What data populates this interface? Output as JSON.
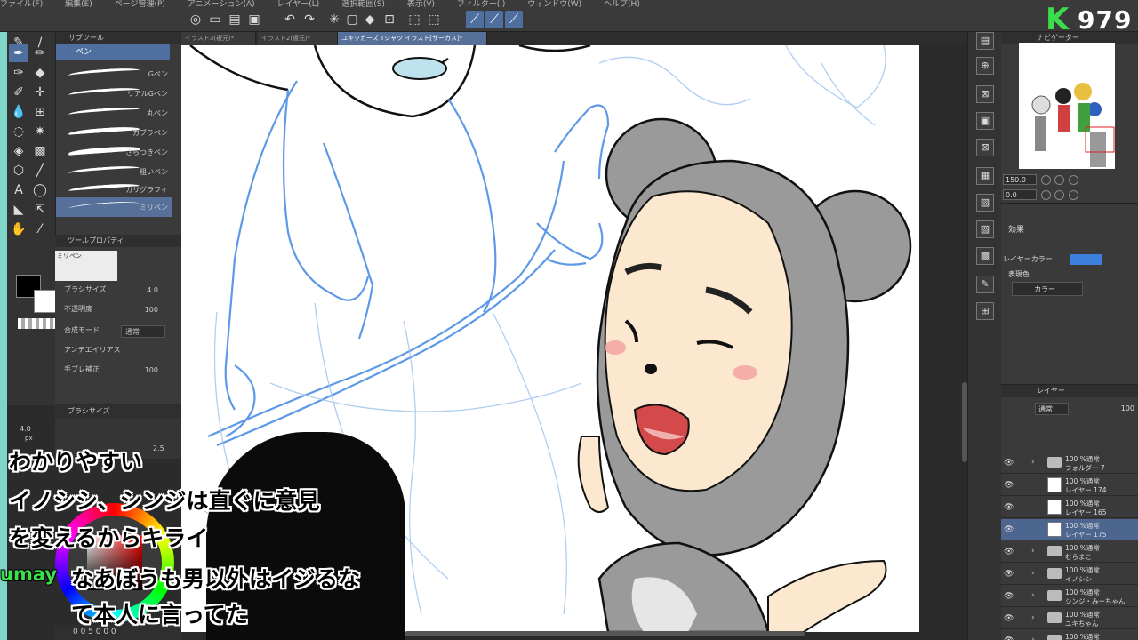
{
  "menu": [
    "ファイル(F)",
    "編集(E)",
    "ページ管理(P)",
    "アニメーション(A)",
    "レイヤー(L)",
    "選択範囲(S)",
    "表示(V)",
    "フィルター(I)",
    "ウィンドウ(W)",
    "ヘルプ(H)"
  ],
  "badge": {
    "logo": "K",
    "number": "979"
  },
  "subtool": {
    "title": "サブツール",
    "active_tab": "ペン",
    "brushes": [
      "Gペン",
      "リアルGペン",
      "丸ペン",
      "カブラペン",
      "さらつきペン",
      "粗いペン",
      "カリグラフィ",
      "ミリペン"
    ]
  },
  "toolprop": {
    "title": "ツールプロパティ",
    "preview_label": "ミリペン",
    "brush_size_label": "ブラシサイズ",
    "brush_size": "4.0",
    "opacity_label": "不透明度",
    "opacity": "100",
    "blend_label": "合成モード",
    "blend": "通常",
    "antialias_label": "アンチエイリアス",
    "stabilize_label": "手ブレ補正",
    "stabilize": "100"
  },
  "brushsize_panel": {
    "title": "ブラシサイズ",
    "size": "4.0",
    "unit": "px",
    "alt": "2.5"
  },
  "doctabs": [
    "イラスト3(複元)*",
    "イラスト2(複元)*",
    "ユキッカーズ Tシャツ イラスト[サーカス]*"
  ],
  "navigator": {
    "title": "ナビゲーター",
    "zoom": "150.0",
    "angle": "0.0"
  },
  "layerprop": {
    "effect_label": "効果",
    "layer_color_label": "レイヤーカラー",
    "expression_label": "表現色",
    "expression_value": "カラー",
    "layer_color": "#3d7fdc"
  },
  "layers": {
    "title": "レイヤー",
    "mode": "通常",
    "opacity": "100",
    "rows": [
      {
        "line1": "100 %通常",
        "line2": "フォルダー 7",
        "type": "folder",
        "selected": false
      },
      {
        "line1": "100 %通常",
        "line2": "レイヤー 174",
        "type": "layer",
        "selected": false
      },
      {
        "line1": "100 %通常",
        "line2": "レイヤー 165",
        "type": "layer",
        "selected": false
      },
      {
        "line1": "100 %通常",
        "line2": "レイヤー 175",
        "type": "layer",
        "selected": true
      },
      {
        "line1": "100 %通常",
        "line2": "むらまこ",
        "type": "folder",
        "selected": false
      },
      {
        "line1": "100 %通常",
        "line2": "イノシシ",
        "type": "folder",
        "selected": false
      },
      {
        "line1": "100 %通常",
        "line2": "シンジ・みーちゃん",
        "type": "folder",
        "selected": false
      },
      {
        "line1": "100 %通常",
        "line2": "ユキちゃん",
        "type": "folder",
        "selected": false
      },
      {
        "line1": "100 %通常",
        "line2": "",
        "type": "folder",
        "selected": false
      }
    ]
  },
  "subtitles": {
    "line1": "わかりやすい",
    "line2": "イノシシ、シンジは直ぐに意見",
    "line3": "を変えるからキライ",
    "speaker": "umay",
    "line4": "なあぼうも男以外はイジるな",
    "line5": "て本人に言ってた"
  },
  "bottom_bar": "0 0 5 0 0 0"
}
